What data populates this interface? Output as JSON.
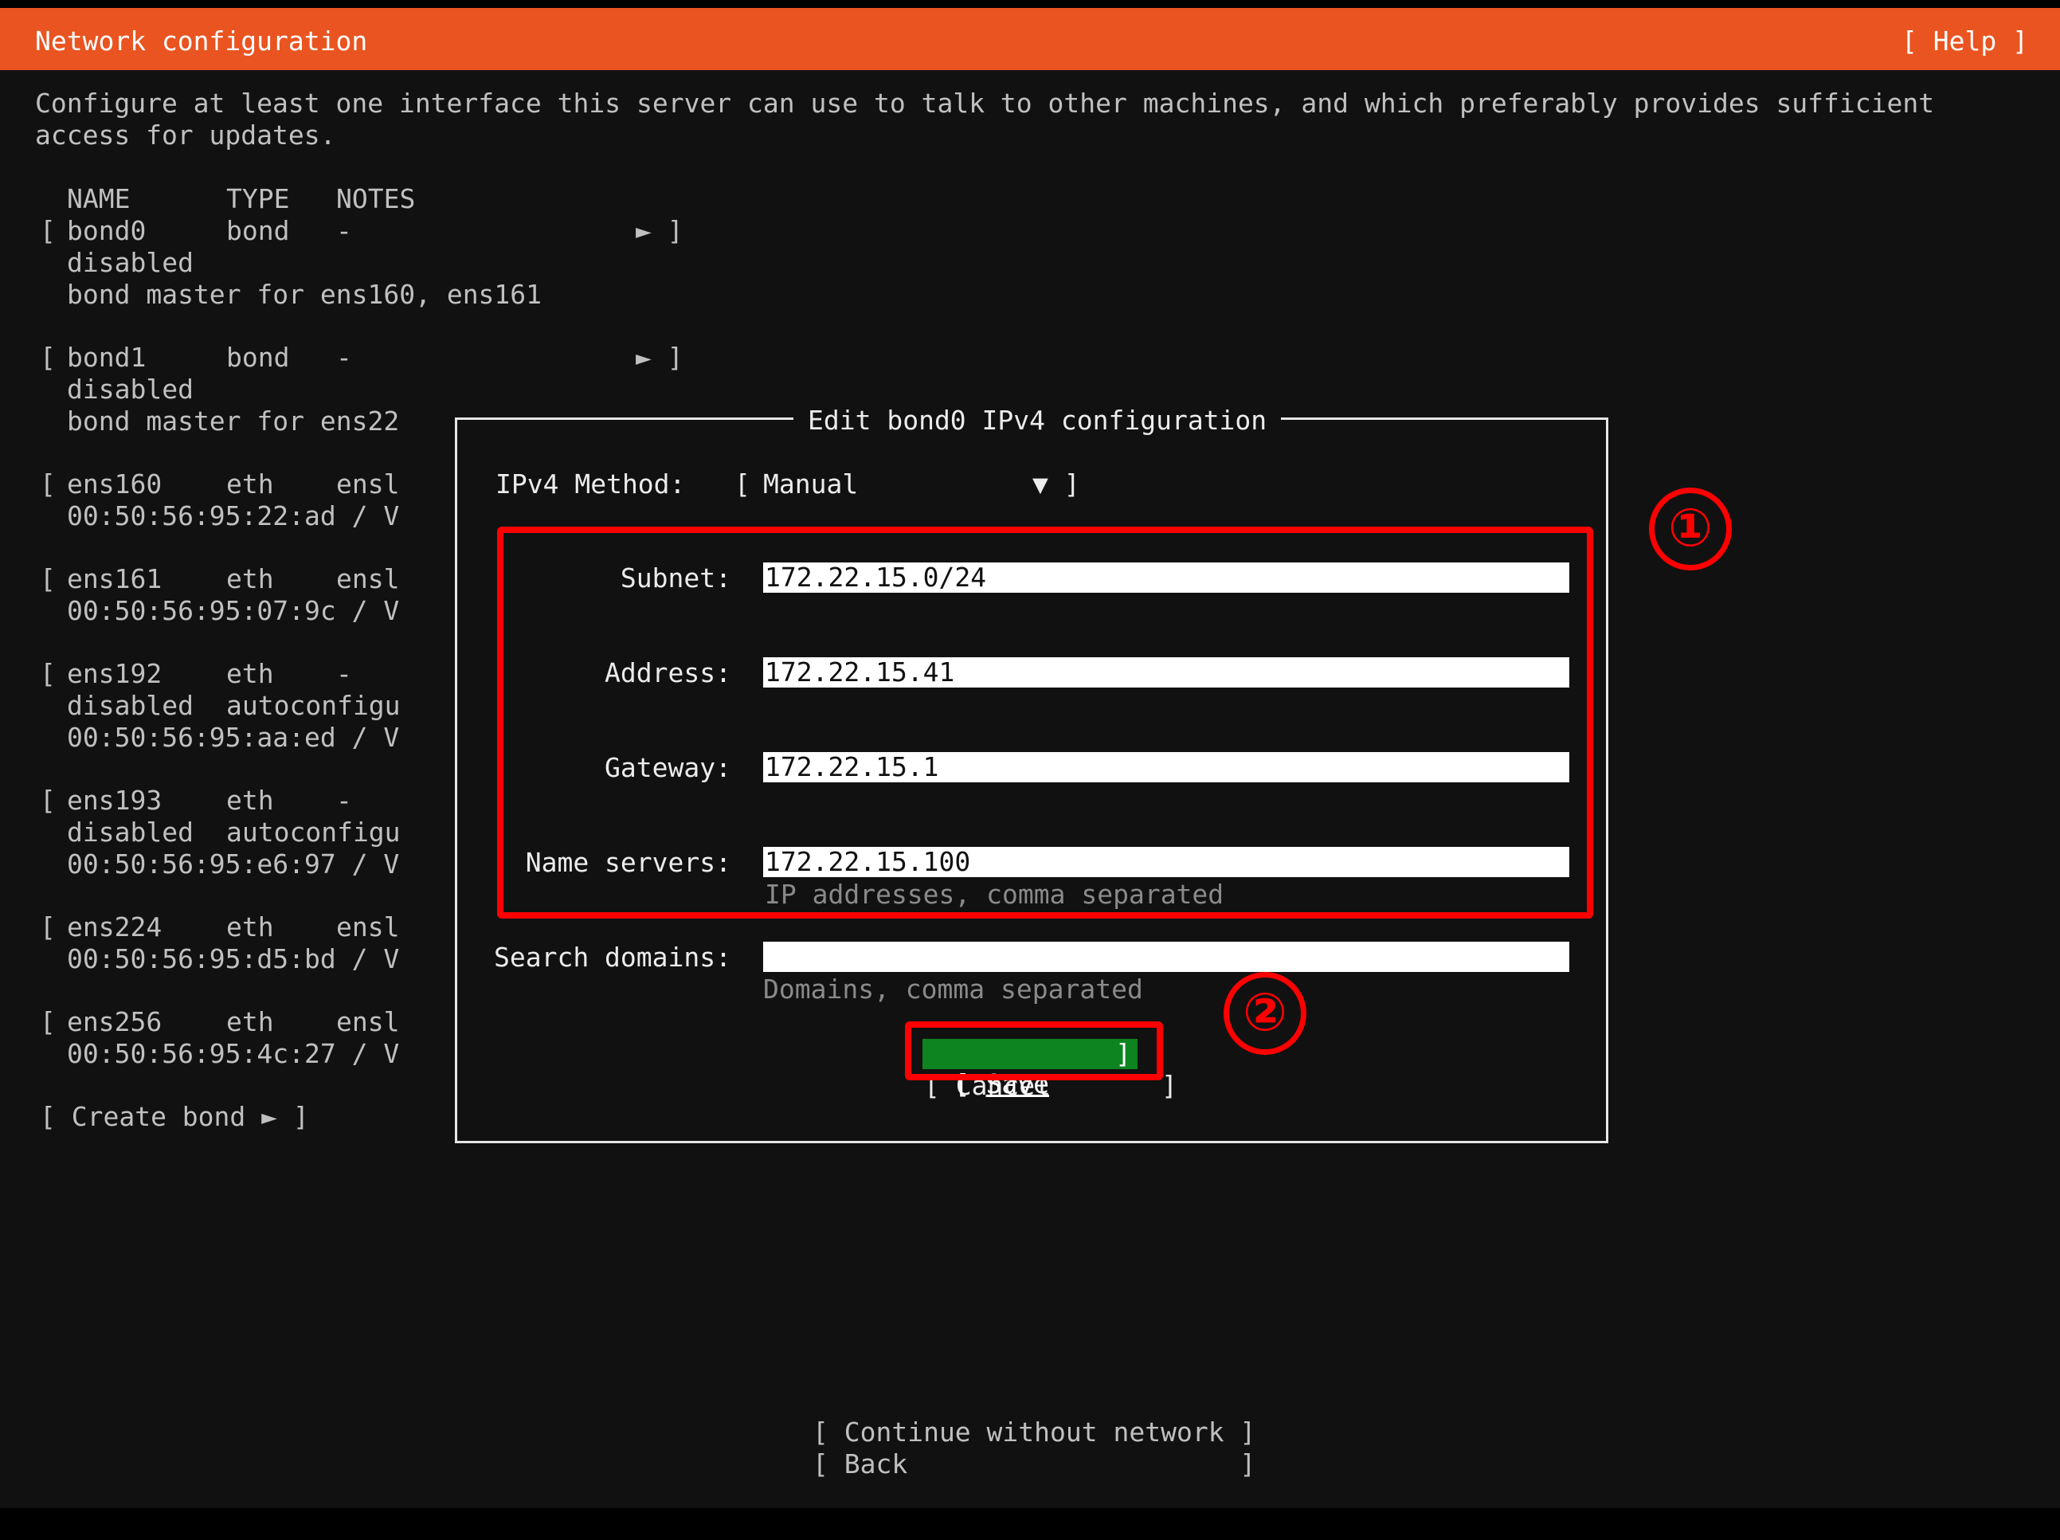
{
  "header": {
    "title": "Network configuration",
    "help": "[ Help ]"
  },
  "intro": {
    "line1": "Configure at least one interface this server can use to talk to other machines, and which preferably provides sufficient",
    "line2": "access for updates."
  },
  "table": {
    "headers": {
      "name": "NAME",
      "type": "TYPE",
      "notes": "NOTES"
    },
    "bond0": {
      "bracket": "[",
      "name": "bond0",
      "type": "bond",
      "notes": "-",
      "arrow": "► ]",
      "status": "disabled",
      "info": "bond master for ens160, ens161"
    },
    "bond1": {
      "bracket": "[",
      "name": "bond1",
      "type": "bond",
      "notes": "-",
      "arrow": "► ]",
      "status": "disabled",
      "info": "bond master for ens22"
    },
    "ens160": {
      "bracket": "[",
      "name": "ens160",
      "type": "eth",
      "notes": "ensl",
      "info": "00:50:56:95:22:ad / V"
    },
    "ens161": {
      "bracket": "[",
      "name": "ens161",
      "type": "eth",
      "notes": "ensl",
      "info": "00:50:56:95:07:9c / V"
    },
    "ens192": {
      "bracket": "[",
      "name": "ens192",
      "type": "eth",
      "notes": "-",
      "status": "disabled",
      "status2": "autoconfigu",
      "info": "00:50:56:95:aa:ed / V"
    },
    "ens193": {
      "bracket": "[",
      "name": "ens193",
      "type": "eth",
      "notes": "-",
      "status": "disabled",
      "status2": "autoconfigu",
      "info": "00:50:56:95:e6:97 / V"
    },
    "ens224": {
      "bracket": "[",
      "name": "ens224",
      "type": "eth",
      "notes": "ensl",
      "info": "00:50:56:95:d5:bd / V"
    },
    "ens256": {
      "bracket": "[",
      "name": "ens256",
      "type": "eth",
      "notes": "ensl",
      "info": "00:50:56:95:4c:27 / V"
    },
    "create_bond": "[ Create bond ► ]"
  },
  "dialog": {
    "title": "Edit bond0 IPv4 configuration",
    "method_label": "IPv4 Method:",
    "method_open": "[",
    "method_value": "Manual",
    "method_arrow": "▼ ]",
    "subnet_label": "Subnet:",
    "subnet_value": "172.22.15.0/24",
    "address_label": "Address:",
    "address_value": "172.22.15.41",
    "gateway_label": "Gateway:",
    "gateway_value": "172.22.15.1",
    "nameservers_label": "Name servers:",
    "nameservers_value": "172.22.15.100",
    "nameservers_hint": "IP addresses, comma separated",
    "search_label": "Search domains:",
    "search_value": "",
    "search_hint": "Domains, comma separated",
    "save_open": "[ ",
    "save_label": "Save",
    "save_close": "]",
    "cancel_label": "[ Cancel       ]"
  },
  "footer": {
    "continue_label": "[ Continue without network ]",
    "back_label": "[ Back                     ]"
  },
  "annotations": {
    "marker1": "①",
    "marker2": "②",
    "color": "#ff0000"
  },
  "colors": {
    "header_bg": "#e95420",
    "save_bg": "#0e8420",
    "background": "#111111"
  }
}
